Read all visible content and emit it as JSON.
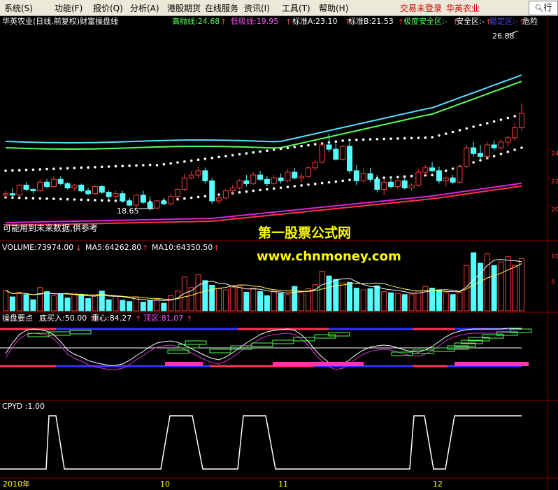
{
  "menu": {
    "items": [
      "系统(S)",
      "功能(F)",
      "报价(Q)",
      "分析(A)",
      "港股期货",
      "在线服务",
      "资讯(I)",
      "工具(T)",
      "帮助(H)"
    ],
    "login_status": "交易未登录",
    "company": "华英农业",
    "search_icon": "search-icon",
    "search_label": "行"
  },
  "main_panel": {
    "title": "华英农业(日线,前复权)财富操盘线",
    "indicators": [
      {
        "label": "高抛线:24.68",
        "color": "#55ff55"
      },
      {
        "label": "低吸线:19.95",
        "color": "#ff55ff"
      },
      {
        "label": "标准A:23.10",
        "color": "#ffffff"
      },
      {
        "label": "标准B:21.53",
        "color": "#ffffff"
      },
      {
        "label": "极度安全区:-",
        "color": "#55ff55"
      },
      {
        "label": "安全区:-",
        "color": "#ffffff"
      },
      {
        "label": "稳定区:-",
        "color": "#5555ff"
      },
      {
        "label": "危险",
        "color": "#ffffff"
      }
    ],
    "high_marker": "26.88",
    "low_marker": "18.65",
    "note": "可能用到未来数据,供参考",
    "price_axis": [
      "24",
      "22",
      "20"
    ]
  },
  "watermark": {
    "title": "第一股票公式网",
    "url": "www.chnmoney.com"
  },
  "volume_panel": {
    "volume": "VOLUME:73974.00",
    "ma5": "MA5:64262.80",
    "ma10": "MA10:64350.50",
    "axis": [
      "10",
      "5"
    ]
  },
  "pattern_panel": {
    "title": "操盘要点",
    "buy": "底买入:50.00",
    "center": "重心:84.27",
    "top": "顶区:81.07"
  },
  "cpyd_panel": {
    "label": "CPYD :1.00"
  },
  "date_axis": [
    "2010年",
    "10",
    "11",
    "12"
  ],
  "colors": {
    "up": "#ff3b3b",
    "down": "#54ffff",
    "upper_band": "#55ddff",
    "green_band": "#55ff55",
    "lower_band": "#dd22dd",
    "lower_band2": "#ff3344"
  },
  "chart_data": {
    "type": "candlestick",
    "candles": [
      [
        20.5,
        20.8,
        20.3,
        20.6
      ],
      [
        20.6,
        21.0,
        20.4,
        20.5
      ],
      [
        20.5,
        21.3,
        20.4,
        21.2
      ],
      [
        21.2,
        21.4,
        20.8,
        20.9
      ],
      [
        20.9,
        21.0,
        20.6,
        20.8
      ],
      [
        20.8,
        21.6,
        20.7,
        21.4
      ],
      [
        21.4,
        21.6,
        21.0,
        21.1
      ],
      [
        21.1,
        21.8,
        21.0,
        21.6
      ],
      [
        21.6,
        21.8,
        21.2,
        21.3
      ],
      [
        21.3,
        21.4,
        20.9,
        21.0
      ],
      [
        21.0,
        21.3,
        20.8,
        21.2
      ],
      [
        21.2,
        21.3,
        20.7,
        20.8
      ],
      [
        20.8,
        21.0,
        20.5,
        20.6
      ],
      [
        20.6,
        21.2,
        20.5,
        21.1
      ],
      [
        21.1,
        21.2,
        20.6,
        20.7
      ],
      [
        20.7,
        20.8,
        20.2,
        20.4
      ],
      [
        20.4,
        20.8,
        20.3,
        20.6
      ],
      [
        20.6,
        20.8,
        20.0,
        20.1
      ],
      [
        20.1,
        20.3,
        19.7,
        19.8
      ],
      [
        19.8,
        20.6,
        19.6,
        20.5
      ],
      [
        20.5,
        20.8,
        19.9,
        20.0
      ],
      [
        20.0,
        20.4,
        19.4,
        19.6
      ],
      [
        19.6,
        20.2,
        19.5,
        20.1
      ],
      [
        20.1,
        20.3,
        19.8,
        19.9
      ],
      [
        19.9,
        20.6,
        19.8,
        20.4
      ],
      [
        20.4,
        21.0,
        20.3,
        20.9
      ],
      [
        20.9,
        22.0,
        20.8,
        21.7
      ],
      [
        21.7,
        22.2,
        21.6,
        21.9
      ],
      [
        21.9,
        22.5,
        21.7,
        22.2
      ],
      [
        22.2,
        22.4,
        21.3,
        21.5
      ],
      [
        21.5,
        21.7,
        19.9,
        20.1
      ],
      [
        20.1,
        20.5,
        19.9,
        20.3
      ],
      [
        20.3,
        20.9,
        20.2,
        20.8
      ],
      [
        20.8,
        21.2,
        20.6,
        21.0
      ],
      [
        21.0,
        21.6,
        20.9,
        21.5
      ],
      [
        21.5,
        21.9,
        21.1,
        21.3
      ],
      [
        21.3,
        22.1,
        21.2,
        21.9
      ],
      [
        21.9,
        22.2,
        21.5,
        21.6
      ],
      [
        21.6,
        21.8,
        21.1,
        21.3
      ],
      [
        21.3,
        21.9,
        21.2,
        21.7
      ],
      [
        21.7,
        22.0,
        21.3,
        21.5
      ],
      [
        21.5,
        22.3,
        21.4,
        22.1
      ],
      [
        22.1,
        22.4,
        21.6,
        21.7
      ],
      [
        21.7,
        22.0,
        21.4,
        21.8
      ],
      [
        21.8,
        22.5,
        21.7,
        22.4
      ],
      [
        22.4,
        23.0,
        22.2,
        22.8
      ],
      [
        22.8,
        24.2,
        22.7,
        24.0
      ],
      [
        24.0,
        24.8,
        23.5,
        23.7
      ],
      [
        23.7,
        24.1,
        22.9,
        23.0
      ],
      [
        23.0,
        24.0,
        22.9,
        23.9
      ],
      [
        23.9,
        24.2,
        22.0,
        22.2
      ],
      [
        22.2,
        22.6,
        21.2,
        21.5
      ],
      [
        21.5,
        22.4,
        21.4,
        22.0
      ],
      [
        22.0,
        22.4,
        21.4,
        21.6
      ],
      [
        21.6,
        21.9,
        20.7,
        20.9
      ],
      [
        20.9,
        21.6,
        20.5,
        21.4
      ],
      [
        21.4,
        21.8,
        21.0,
        21.1
      ],
      [
        21.1,
        21.6,
        20.9,
        21.5
      ],
      [
        21.5,
        21.7,
        20.9,
        21.0
      ],
      [
        21.0,
        21.3,
        20.8,
        21.2
      ],
      [
        21.2,
        22.3,
        21.1,
        22.1
      ],
      [
        22.1,
        22.6,
        21.9,
        22.4
      ],
      [
        22.4,
        22.8,
        22.1,
        22.2
      ],
      [
        22.2,
        22.5,
        21.3,
        21.5
      ],
      [
        21.5,
        21.8,
        21.1,
        21.7
      ],
      [
        21.7,
        21.9,
        21.3,
        21.4
      ],
      [
        21.4,
        22.6,
        21.3,
        22.5
      ],
      [
        22.5,
        24.0,
        22.4,
        23.8
      ],
      [
        23.8,
        24.2,
        23.2,
        23.4
      ],
      [
        23.4,
        24.0,
        23.0,
        23.2
      ],
      [
        23.2,
        24.2,
        23.0,
        24.0
      ],
      [
        24.0,
        24.3,
        23.6,
        23.8
      ],
      [
        23.8,
        24.4,
        23.6,
        24.2
      ],
      [
        24.2,
        24.6,
        23.9,
        24.5
      ],
      [
        24.5,
        25.5,
        24.3,
        25.2
      ],
      [
        25.2,
        26.9,
        25.0,
        26.2
      ]
    ],
    "bands": [
      "upper",
      "green",
      "white-dotted",
      "lower-dotted",
      "magenta",
      "red"
    ],
    "volume_values": [
      3.5,
      2.4,
      3.2,
      2.8,
      1.9,
      4.0,
      3.3,
      2.6,
      2.9,
      2.2,
      3.0,
      2.7,
      2.1,
      2.6,
      3.4,
      1.9,
      2.5,
      1.8,
      1.6,
      2.4,
      1.5,
      1.7,
      2.0,
      1.3,
      2.6,
      3.4,
      5.8,
      4.0,
      6.2,
      5.2,
      4.4,
      3.8,
      3.6,
      4.0,
      4.2,
      3.2,
      3.9,
      3.3,
      2.6,
      3.4,
      3.0,
      2.8,
      4.2,
      3.1,
      3.8,
      4.5,
      6.8,
      6.0,
      5.4,
      4.8,
      4.9,
      3.9,
      3.6,
      3.8,
      4.3,
      3.3,
      3.1,
      3.0,
      2.8,
      2.9,
      3.4,
      4.2,
      3.9,
      3.6,
      3.1,
      2.8,
      3.2,
      7.8,
      10.0,
      8.2,
      9.8,
      7.8,
      8.4,
      9.3,
      7.8,
      9.0
    ]
  }
}
